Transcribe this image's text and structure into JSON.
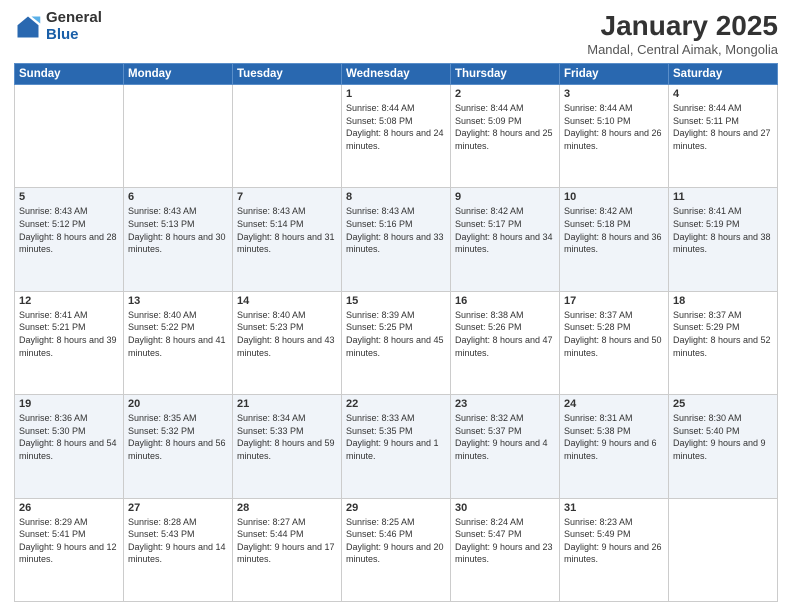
{
  "logo": {
    "general": "General",
    "blue": "Blue"
  },
  "title": "January 2025",
  "subtitle": "Mandal, Central Aimak, Mongolia",
  "weekdays": [
    "Sunday",
    "Monday",
    "Tuesday",
    "Wednesday",
    "Thursday",
    "Friday",
    "Saturday"
  ],
  "weeks": [
    [
      {
        "day": "",
        "sunrise": "",
        "sunset": "",
        "daylight": ""
      },
      {
        "day": "",
        "sunrise": "",
        "sunset": "",
        "daylight": ""
      },
      {
        "day": "",
        "sunrise": "",
        "sunset": "",
        "daylight": ""
      },
      {
        "day": "1",
        "sunrise": "Sunrise: 8:44 AM",
        "sunset": "Sunset: 5:08 PM",
        "daylight": "Daylight: 8 hours and 24 minutes."
      },
      {
        "day": "2",
        "sunrise": "Sunrise: 8:44 AM",
        "sunset": "Sunset: 5:09 PM",
        "daylight": "Daylight: 8 hours and 25 minutes."
      },
      {
        "day": "3",
        "sunrise": "Sunrise: 8:44 AM",
        "sunset": "Sunset: 5:10 PM",
        "daylight": "Daylight: 8 hours and 26 minutes."
      },
      {
        "day": "4",
        "sunrise": "Sunrise: 8:44 AM",
        "sunset": "Sunset: 5:11 PM",
        "daylight": "Daylight: 8 hours and 27 minutes."
      }
    ],
    [
      {
        "day": "5",
        "sunrise": "Sunrise: 8:43 AM",
        "sunset": "Sunset: 5:12 PM",
        "daylight": "Daylight: 8 hours and 28 minutes."
      },
      {
        "day": "6",
        "sunrise": "Sunrise: 8:43 AM",
        "sunset": "Sunset: 5:13 PM",
        "daylight": "Daylight: 8 hours and 30 minutes."
      },
      {
        "day": "7",
        "sunrise": "Sunrise: 8:43 AM",
        "sunset": "Sunset: 5:14 PM",
        "daylight": "Daylight: 8 hours and 31 minutes."
      },
      {
        "day": "8",
        "sunrise": "Sunrise: 8:43 AM",
        "sunset": "Sunset: 5:16 PM",
        "daylight": "Daylight: 8 hours and 33 minutes."
      },
      {
        "day": "9",
        "sunrise": "Sunrise: 8:42 AM",
        "sunset": "Sunset: 5:17 PM",
        "daylight": "Daylight: 8 hours and 34 minutes."
      },
      {
        "day": "10",
        "sunrise": "Sunrise: 8:42 AM",
        "sunset": "Sunset: 5:18 PM",
        "daylight": "Daylight: 8 hours and 36 minutes."
      },
      {
        "day": "11",
        "sunrise": "Sunrise: 8:41 AM",
        "sunset": "Sunset: 5:19 PM",
        "daylight": "Daylight: 8 hours and 38 minutes."
      }
    ],
    [
      {
        "day": "12",
        "sunrise": "Sunrise: 8:41 AM",
        "sunset": "Sunset: 5:21 PM",
        "daylight": "Daylight: 8 hours and 39 minutes."
      },
      {
        "day": "13",
        "sunrise": "Sunrise: 8:40 AM",
        "sunset": "Sunset: 5:22 PM",
        "daylight": "Daylight: 8 hours and 41 minutes."
      },
      {
        "day": "14",
        "sunrise": "Sunrise: 8:40 AM",
        "sunset": "Sunset: 5:23 PM",
        "daylight": "Daylight: 8 hours and 43 minutes."
      },
      {
        "day": "15",
        "sunrise": "Sunrise: 8:39 AM",
        "sunset": "Sunset: 5:25 PM",
        "daylight": "Daylight: 8 hours and 45 minutes."
      },
      {
        "day": "16",
        "sunrise": "Sunrise: 8:38 AM",
        "sunset": "Sunset: 5:26 PM",
        "daylight": "Daylight: 8 hours and 47 minutes."
      },
      {
        "day": "17",
        "sunrise": "Sunrise: 8:37 AM",
        "sunset": "Sunset: 5:28 PM",
        "daylight": "Daylight: 8 hours and 50 minutes."
      },
      {
        "day": "18",
        "sunrise": "Sunrise: 8:37 AM",
        "sunset": "Sunset: 5:29 PM",
        "daylight": "Daylight: 8 hours and 52 minutes."
      }
    ],
    [
      {
        "day": "19",
        "sunrise": "Sunrise: 8:36 AM",
        "sunset": "Sunset: 5:30 PM",
        "daylight": "Daylight: 8 hours and 54 minutes."
      },
      {
        "day": "20",
        "sunrise": "Sunrise: 8:35 AM",
        "sunset": "Sunset: 5:32 PM",
        "daylight": "Daylight: 8 hours and 56 minutes."
      },
      {
        "day": "21",
        "sunrise": "Sunrise: 8:34 AM",
        "sunset": "Sunset: 5:33 PM",
        "daylight": "Daylight: 8 hours and 59 minutes."
      },
      {
        "day": "22",
        "sunrise": "Sunrise: 8:33 AM",
        "sunset": "Sunset: 5:35 PM",
        "daylight": "Daylight: 9 hours and 1 minute."
      },
      {
        "day": "23",
        "sunrise": "Sunrise: 8:32 AM",
        "sunset": "Sunset: 5:37 PM",
        "daylight": "Daylight: 9 hours and 4 minutes."
      },
      {
        "day": "24",
        "sunrise": "Sunrise: 8:31 AM",
        "sunset": "Sunset: 5:38 PM",
        "daylight": "Daylight: 9 hours and 6 minutes."
      },
      {
        "day": "25",
        "sunrise": "Sunrise: 8:30 AM",
        "sunset": "Sunset: 5:40 PM",
        "daylight": "Daylight: 9 hours and 9 minutes."
      }
    ],
    [
      {
        "day": "26",
        "sunrise": "Sunrise: 8:29 AM",
        "sunset": "Sunset: 5:41 PM",
        "daylight": "Daylight: 9 hours and 12 minutes."
      },
      {
        "day": "27",
        "sunrise": "Sunrise: 8:28 AM",
        "sunset": "Sunset: 5:43 PM",
        "daylight": "Daylight: 9 hours and 14 minutes."
      },
      {
        "day": "28",
        "sunrise": "Sunrise: 8:27 AM",
        "sunset": "Sunset: 5:44 PM",
        "daylight": "Daylight: 9 hours and 17 minutes."
      },
      {
        "day": "29",
        "sunrise": "Sunrise: 8:25 AM",
        "sunset": "Sunset: 5:46 PM",
        "daylight": "Daylight: 9 hours and 20 minutes."
      },
      {
        "day": "30",
        "sunrise": "Sunrise: 8:24 AM",
        "sunset": "Sunset: 5:47 PM",
        "daylight": "Daylight: 9 hours and 23 minutes."
      },
      {
        "day": "31",
        "sunrise": "Sunrise: 8:23 AM",
        "sunset": "Sunset: 5:49 PM",
        "daylight": "Daylight: 9 hours and 26 minutes."
      },
      {
        "day": "",
        "sunrise": "",
        "sunset": "",
        "daylight": ""
      }
    ]
  ]
}
